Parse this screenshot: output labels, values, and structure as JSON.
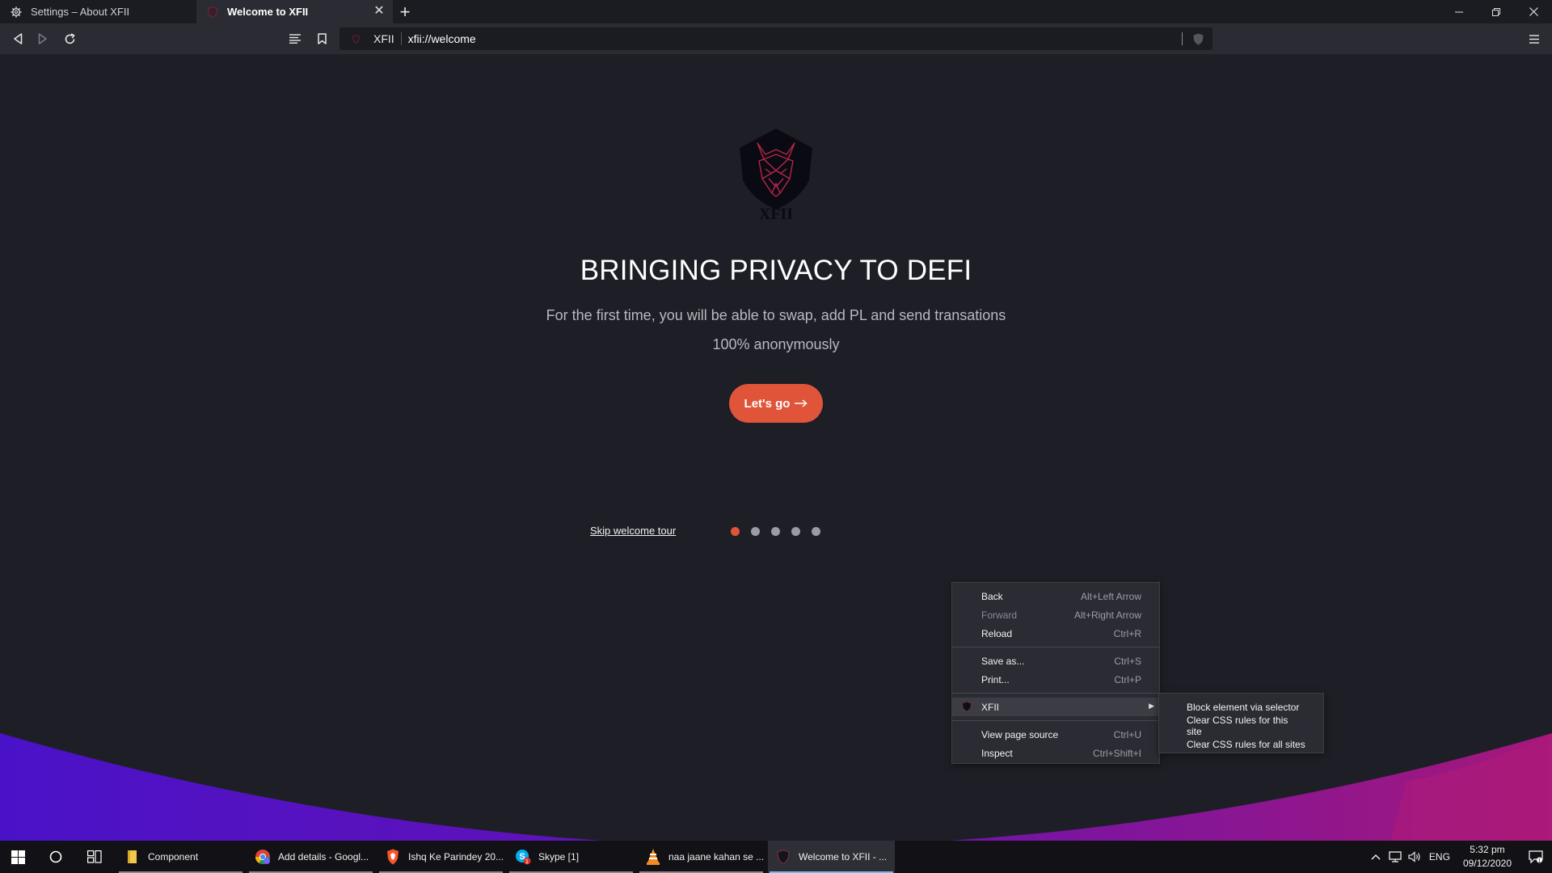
{
  "tabs": [
    {
      "title": "Settings – About XFII",
      "icon": "gear-icon",
      "active": false
    },
    {
      "title": "Welcome to XFII",
      "icon": "xfii-shield-icon",
      "active": true
    }
  ],
  "toolbar": {
    "site_label": "XFII",
    "url": "xfii://welcome"
  },
  "page": {
    "logo_text": "XFII",
    "title": "BRINGING PRIVACY TO DEFI",
    "subtitle": "For the first time, you will be able to swap, add PL and send transations 100% anonymously",
    "cta_label": "Let's go",
    "cta_icon": "arrow-right-icon",
    "skip_label": "Skip welcome tour",
    "tour_steps": 5,
    "tour_active_step": 1
  },
  "context_menu": {
    "back": {
      "label": "Back",
      "shortcut": "Alt+Left Arrow"
    },
    "forward": {
      "label": "Forward",
      "shortcut": "Alt+Right Arrow"
    },
    "reload": {
      "label": "Reload",
      "shortcut": "Ctrl+R"
    },
    "save_as": {
      "label": "Save as...",
      "shortcut": "Ctrl+S"
    },
    "print": {
      "label": "Print...",
      "shortcut": "Ctrl+P"
    },
    "xfii": {
      "label": "XFII"
    },
    "view_source": {
      "label": "View page source",
      "shortcut": "Ctrl+U"
    },
    "inspect": {
      "label": "Inspect",
      "shortcut": "Ctrl+Shift+I"
    }
  },
  "submenu": {
    "block": "Block element via selector",
    "clear_site": "Clear CSS rules for this site",
    "clear_all": "Clear CSS rules for all sites"
  },
  "taskbar": {
    "tasks": [
      {
        "label": "Component",
        "icon": "folder-icon"
      },
      {
        "label": "Add details - Googl...",
        "icon": "chrome-icon"
      },
      {
        "label": "Ishq Ke Parindey 20...",
        "icon": "brave-icon"
      },
      {
        "label": "Skype [1]",
        "icon": "skype-icon"
      },
      {
        "label": "naa jaane kahan se ...",
        "icon": "vlc-icon"
      },
      {
        "label": "Welcome to XFII - ...",
        "icon": "xfii-shield-icon"
      }
    ],
    "language": "ENG",
    "time": "5:32 pm",
    "date": "09/12/2020"
  },
  "colors": {
    "accent": "#e0553a",
    "background": "#1e1f26",
    "wave_left": "#4a12c8",
    "wave_right": "#a4187a"
  }
}
